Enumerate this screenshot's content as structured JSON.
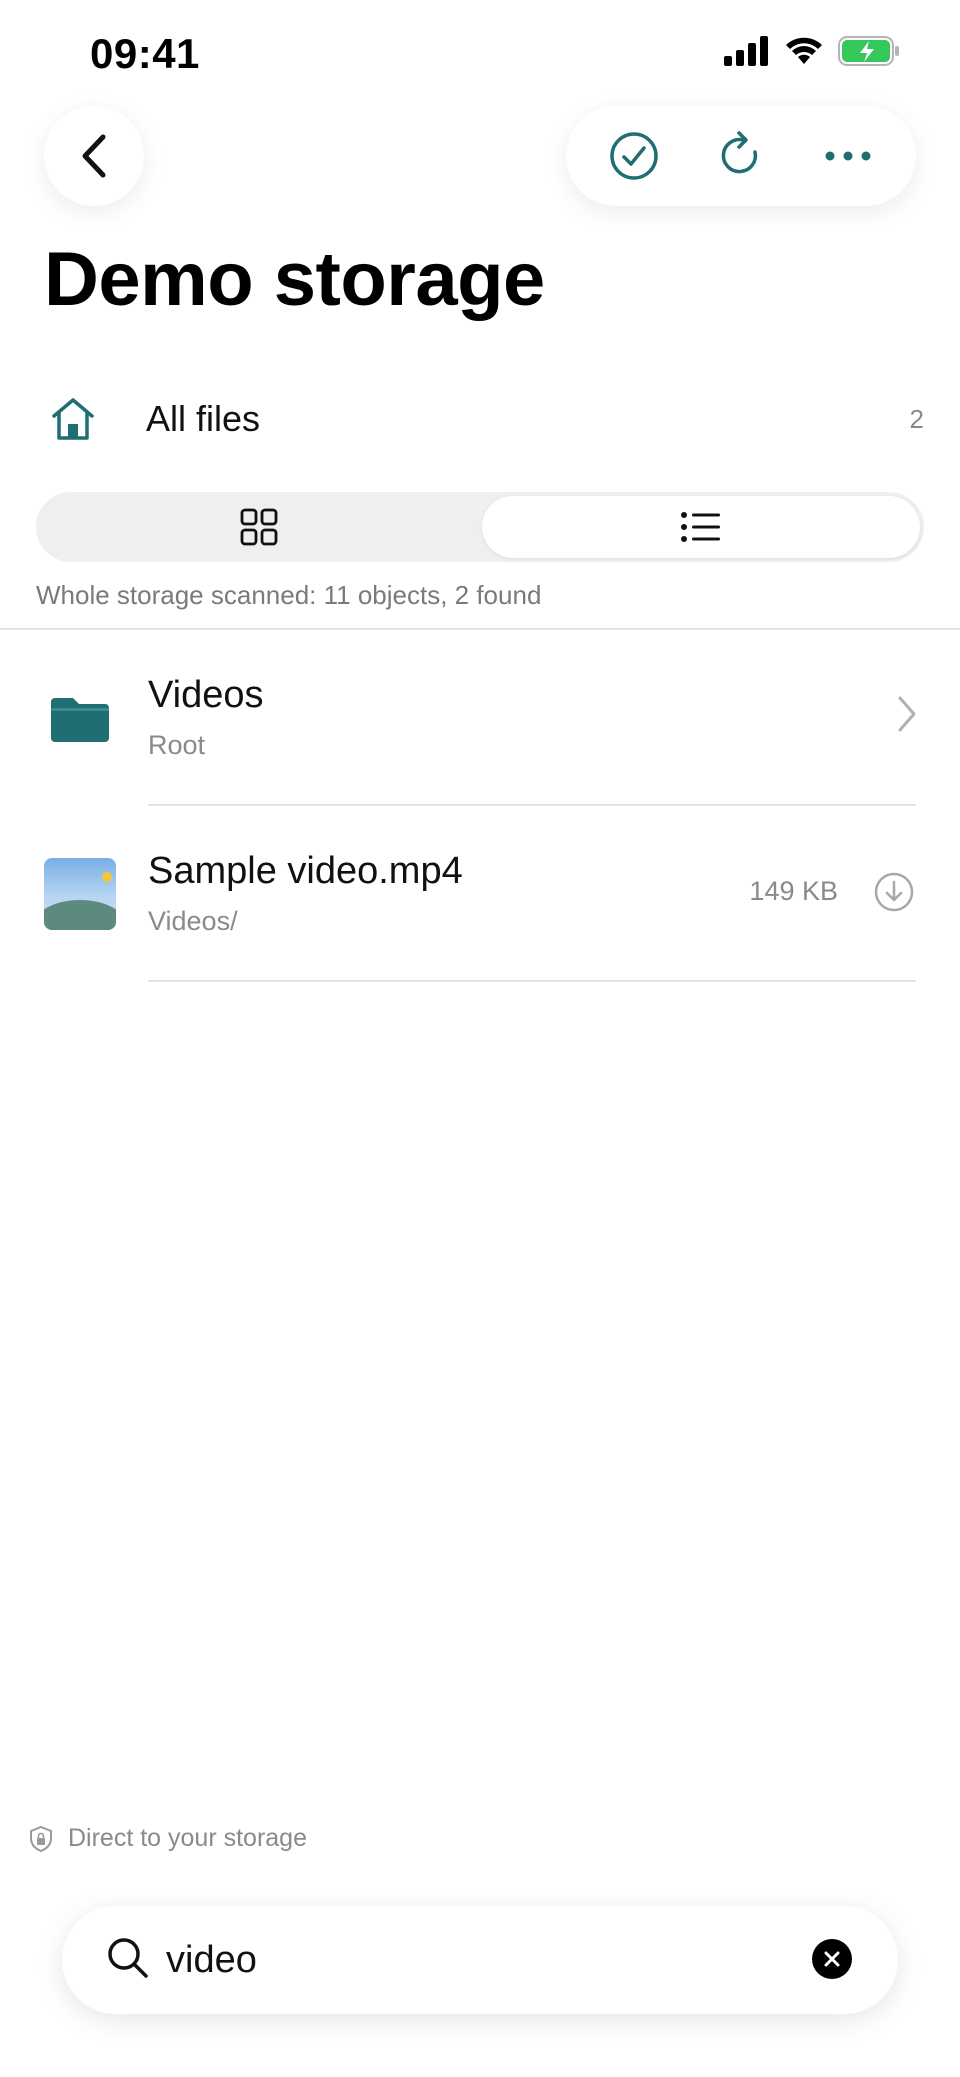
{
  "status_bar": {
    "time": "09:41"
  },
  "colors": {
    "accent": "#1e6e72",
    "muted_text": "#8a8a8a",
    "divider": "#e4e4e4",
    "battery_green": "#34c759"
  },
  "header": {
    "back_icon": "chevron-left-icon",
    "toolbar_icons": [
      "checkmark-circle-icon",
      "refresh-icon",
      "ellipsis-icon"
    ],
    "title": "Demo storage"
  },
  "location": {
    "label": "All files",
    "count": "2"
  },
  "view_toggle": {
    "options": [
      "grid",
      "list"
    ],
    "selected": "list"
  },
  "scan_status": "Whole storage scanned: 11 objects, 2 found",
  "results": [
    {
      "name": "Videos",
      "path": "Root",
      "type": "folder"
    },
    {
      "name": "Sample video.mp4",
      "path": "Videos/",
      "size": "149 KB",
      "type": "video"
    }
  ],
  "footer": {
    "storage_note": "Direct to your storage",
    "search": {
      "value": "video"
    }
  }
}
